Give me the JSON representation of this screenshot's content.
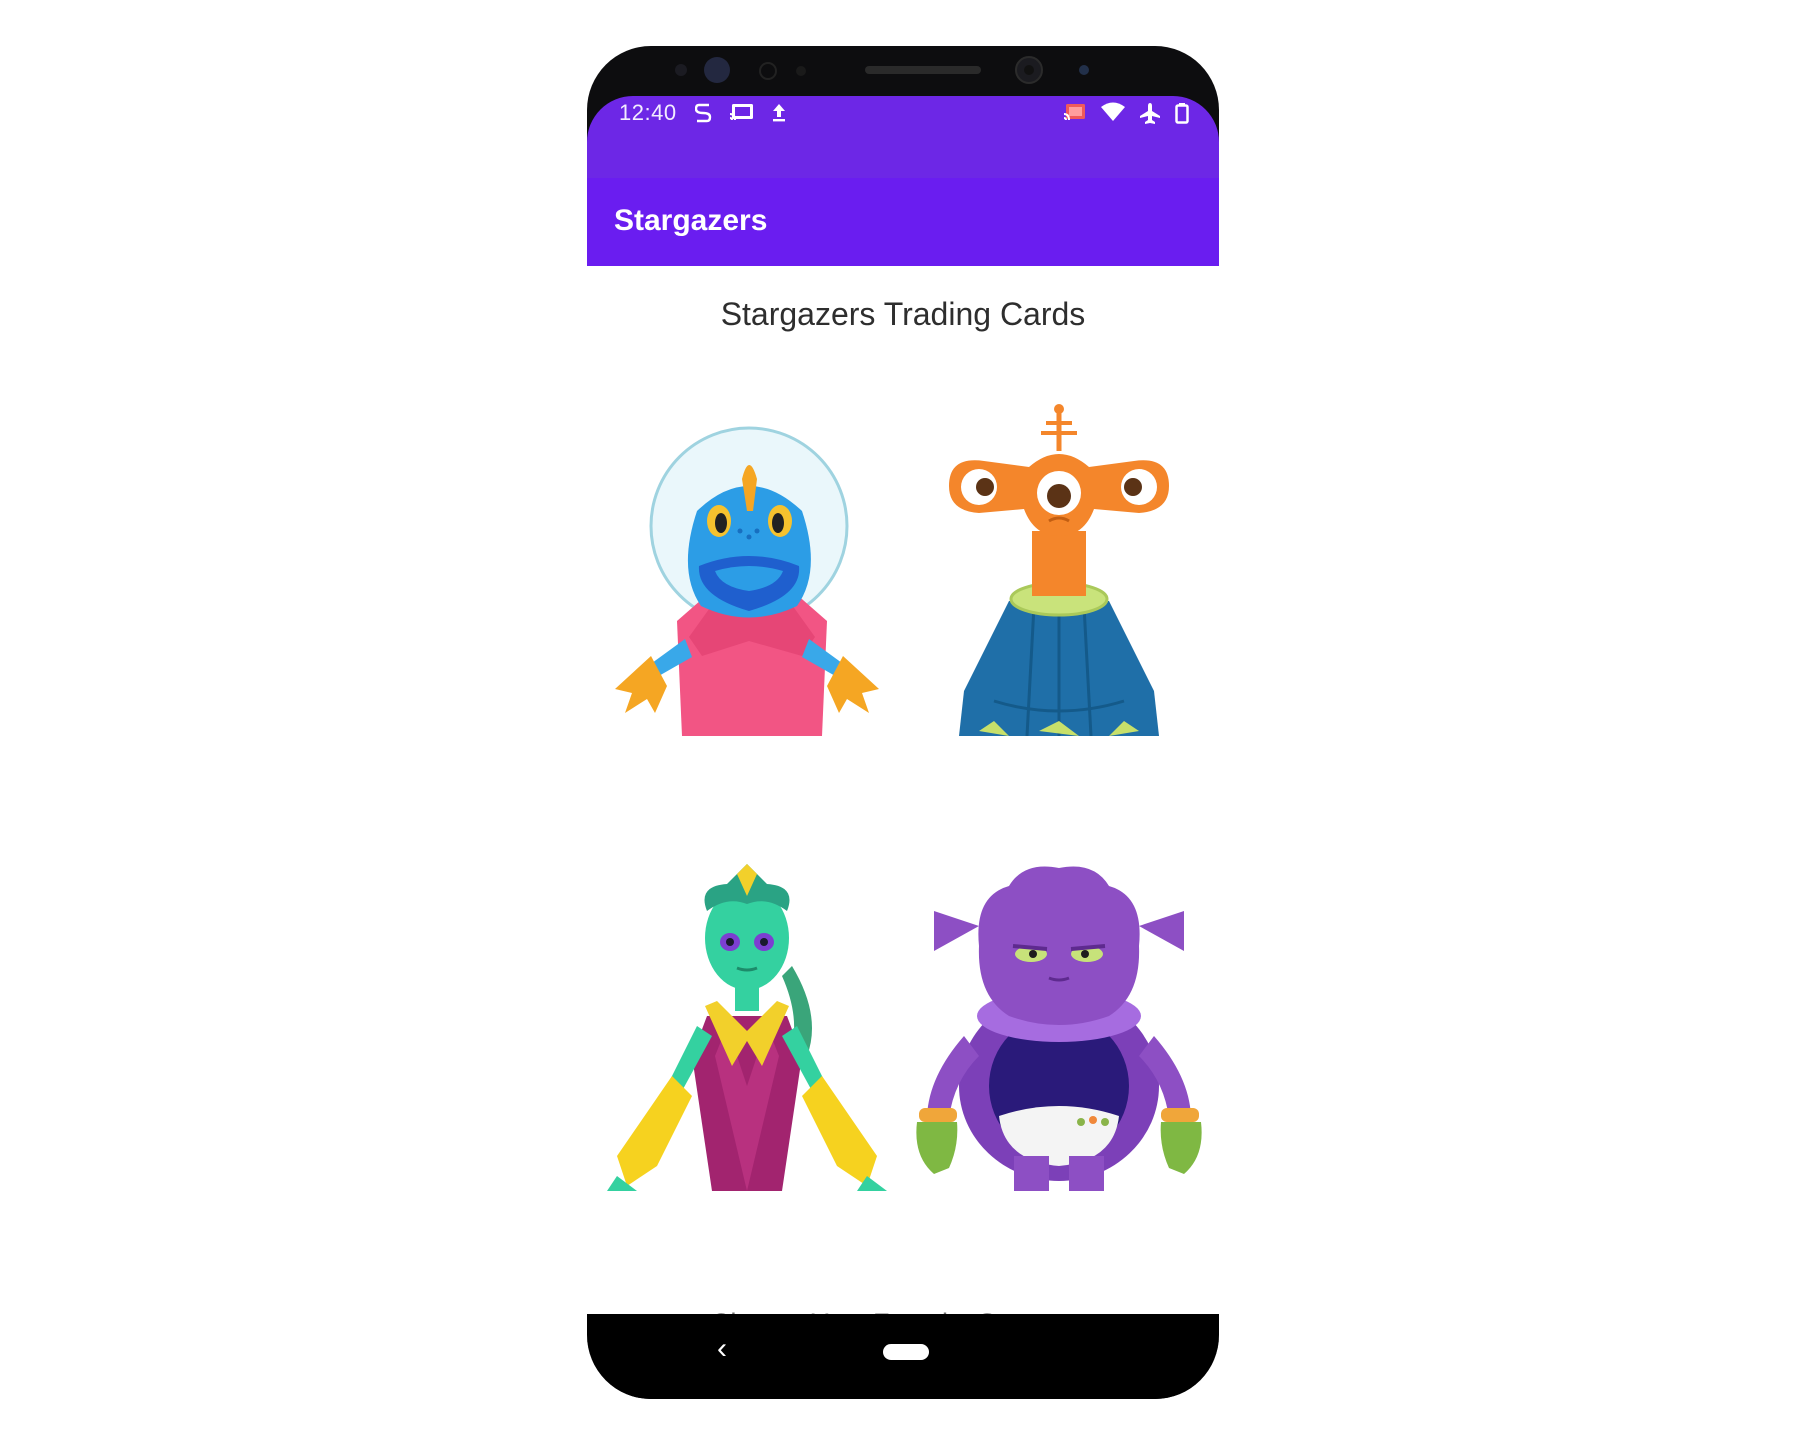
{
  "status_bar": {
    "time": "12:40",
    "left_icons": [
      "sim-icon",
      "cast-icon",
      "upload-icon"
    ],
    "right_icons": [
      "cast-connected-icon",
      "wifi-icon",
      "airplane-icon",
      "battery-icon"
    ]
  },
  "app_bar": {
    "title": "Stargazers",
    "color": "#6a1df0"
  },
  "main": {
    "heading": "Stargazers Trading Cards",
    "cards": [
      {
        "character": "blue-fish-astronaut"
      },
      {
        "character": "orange-three-eyed-alien"
      },
      {
        "character": "green-alien-queen"
      },
      {
        "character": "purple-furry-alien"
      }
    ],
    "footer": "Choose Your Favorite Stargazer"
  },
  "nav_bar": {
    "icons": [
      "back-icon",
      "home-pill-icon"
    ]
  }
}
